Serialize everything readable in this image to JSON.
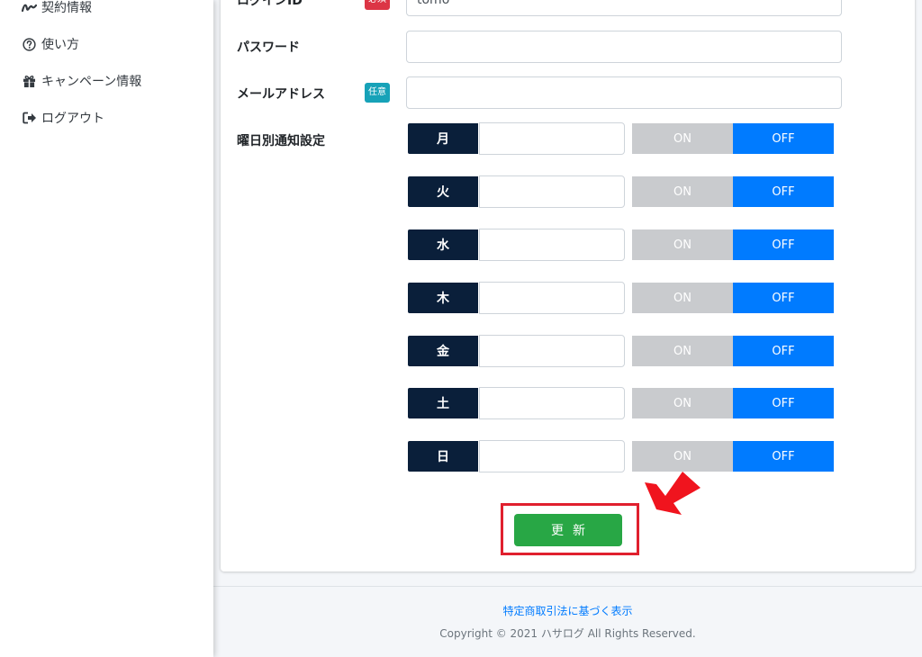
{
  "sidebar": {
    "items": [
      {
        "label": "契約情報",
        "icon": "signature-icon"
      },
      {
        "label": "使い方",
        "icon": "question-circle-icon"
      },
      {
        "label": "キャンペーン情報",
        "icon": "gift-icon"
      },
      {
        "label": "ログアウト",
        "icon": "sign-out-icon"
      }
    ]
  },
  "form": {
    "login_id": {
      "label": "ログインID",
      "badge": "必須",
      "value": "tomo"
    },
    "password": {
      "label": "パスワード",
      "value": ""
    },
    "email": {
      "label": "メールアドレス",
      "badge": "任意",
      "value": ""
    },
    "weekly": {
      "label": "曜日別通知設定",
      "on_label": "ON",
      "off_label": "OFF",
      "days": [
        {
          "day": "月",
          "value": "",
          "state": "OFF"
        },
        {
          "day": "火",
          "value": "",
          "state": "OFF"
        },
        {
          "day": "水",
          "value": "",
          "state": "OFF"
        },
        {
          "day": "木",
          "value": "",
          "state": "OFF"
        },
        {
          "day": "金",
          "value": "",
          "state": "OFF"
        },
        {
          "day": "土",
          "value": "",
          "state": "OFF"
        },
        {
          "day": "日",
          "value": "",
          "state": "OFF"
        }
      ]
    },
    "submit_label": "更新"
  },
  "footer": {
    "link": "特定商取引法に基づく表示",
    "copyright": "Copyright © 2021 ハサログ All Rights Reserved."
  },
  "colors": {
    "day_label_bg": "#0a1f3a",
    "off_active": "#007bff",
    "on_inactive": "#c9cbce",
    "submit": "#28a745",
    "highlight": "#e0202e"
  }
}
